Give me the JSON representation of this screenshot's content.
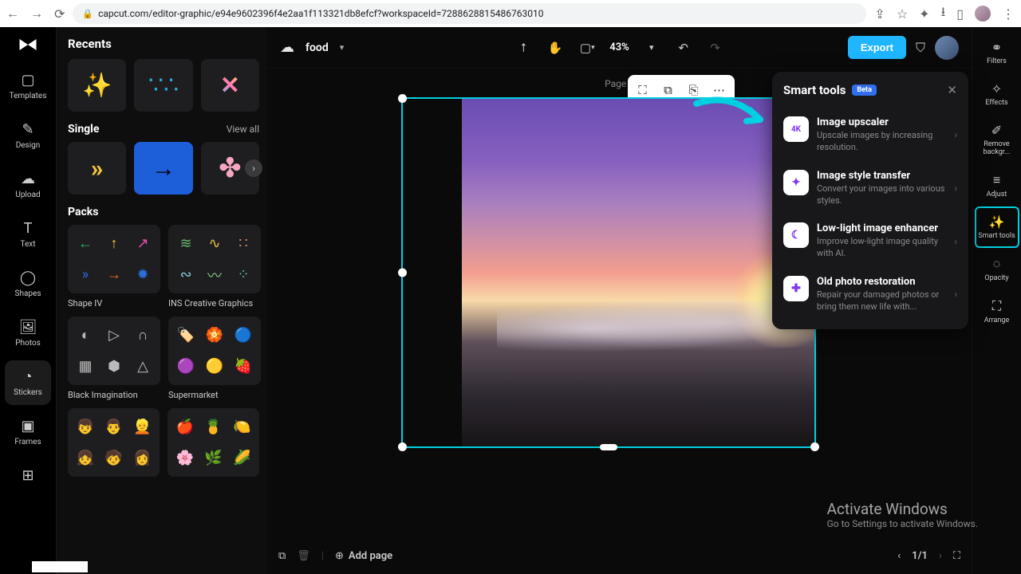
{
  "browser": {
    "url": "capcut.com/editor-graphic/e94e9602396f4e2aa1f113321db8efcf?workspaceId=7288628815486763010"
  },
  "leftRail": {
    "items": [
      "Templates",
      "Design",
      "Upload",
      "Text",
      "Shapes",
      "Photos",
      "Stickers",
      "Frames"
    ],
    "active": "Stickers"
  },
  "stickersPanel": {
    "recents": "Recents",
    "singleHdr": "Single",
    "viewAll": "View all",
    "packsHdr": "Packs",
    "packs": [
      "Shape IV",
      "INS Creative Graphics",
      "Black Imagination",
      "Supermarket"
    ]
  },
  "topbar": {
    "docName": "food",
    "zoom": "43%",
    "export": "Export"
  },
  "canvas": {
    "pageLabel": "Page 1"
  },
  "bottom": {
    "addPage": "Add page",
    "pageIndicator": "1/1"
  },
  "rightRail": {
    "items": [
      "Filters",
      "Effects",
      "Remove backgr...",
      "Adjust",
      "Smart tools",
      "Opacity",
      "Arrange"
    ],
    "highlight": "Smart tools"
  },
  "smartTools": {
    "title": "Smart tools",
    "badge": "Beta",
    "items": [
      {
        "title": "Image upscaler",
        "desc": "Upscale images by increasing resolution.",
        "ico": "4K"
      },
      {
        "title": "Image style transfer",
        "desc": "Convert your images into various styles.",
        "ico": "✦"
      },
      {
        "title": "Low-light image enhancer",
        "desc": "Improve low-light image quality with AI.",
        "ico": "☾"
      },
      {
        "title": "Old photo restoration",
        "desc": "Repair your damaged photos or bring them new life with...",
        "ico": "✚"
      }
    ]
  },
  "watermark": {
    "title": "Activate Windows",
    "sub": "Go to Settings to activate Windows."
  }
}
